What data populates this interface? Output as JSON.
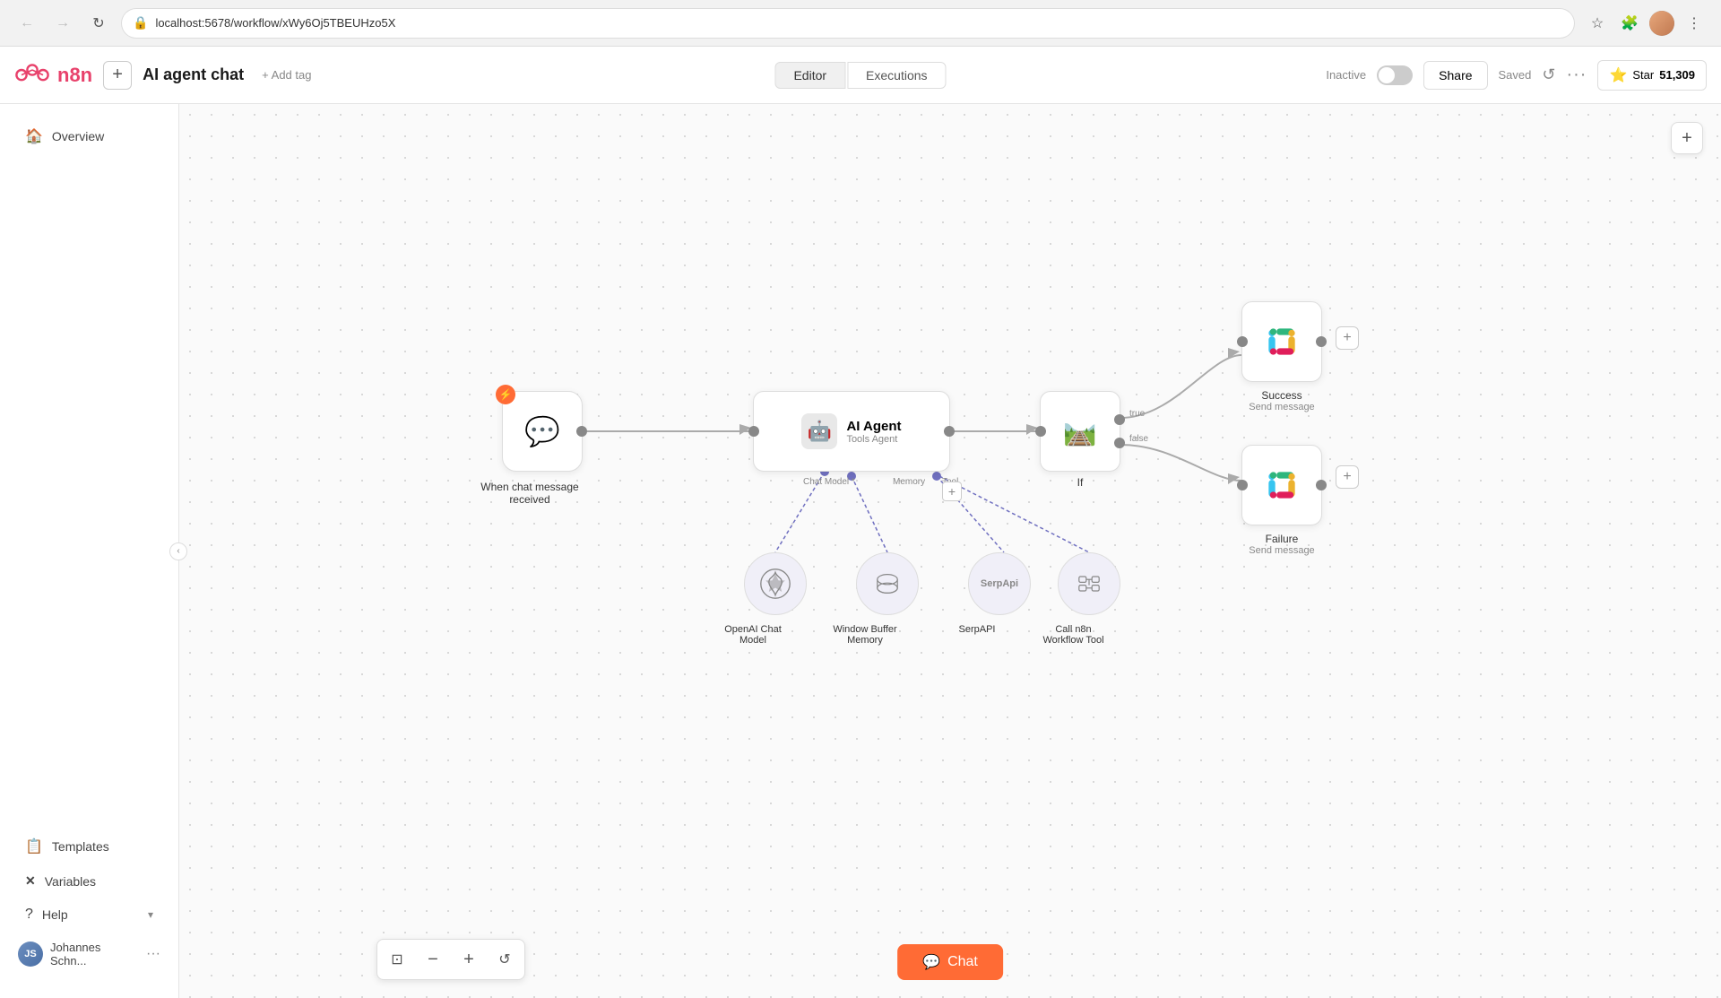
{
  "browser": {
    "url": "localhost:5678/workflow/xWy6Oj5TBEUHzo5X",
    "back_disabled": true,
    "forward_disabled": true
  },
  "app": {
    "logo_text": "n8n",
    "add_button_label": "+",
    "workflow_name": "AI agent chat",
    "add_tag_label": "+ Add tag",
    "tabs": [
      {
        "id": "editor",
        "label": "Editor",
        "active": true
      },
      {
        "id": "executions",
        "label": "Executions",
        "active": false
      }
    ],
    "status": {
      "inactive_label": "Inactive",
      "share_label": "Share",
      "saved_label": "Saved"
    },
    "star_button": {
      "label": "Star",
      "count": "51,309"
    },
    "more_label": "···"
  },
  "sidebar": {
    "items": [
      {
        "id": "overview",
        "label": "Overview",
        "icon": "🏠"
      },
      {
        "id": "templates",
        "label": "Templates",
        "icon": "📋"
      },
      {
        "id": "variables",
        "label": "Variables",
        "icon": "✕"
      },
      {
        "id": "help",
        "label": "Help",
        "icon": "?"
      }
    ],
    "user": {
      "initials": "JS",
      "name": "Johannes Schn...",
      "more_label": "···"
    }
  },
  "workflow": {
    "nodes": {
      "trigger": {
        "label": "When chat message",
        "label2": "received"
      },
      "ai_agent": {
        "title": "AI Agent",
        "subtitle": "Tools Agent",
        "chat_model_label": "Chat Model *",
        "memory_label": "Memory",
        "tool_label": "Tool"
      },
      "if_node": {
        "label": "If",
        "true_label": "true",
        "false_label": "false"
      },
      "slack_success": {
        "label": "Success",
        "sublabel": "Send message"
      },
      "slack_failure": {
        "label": "Failure",
        "sublabel": "Send message"
      },
      "openai": {
        "label": "OpenAI Chat",
        "label2": "Model"
      },
      "memory": {
        "label": "Window Buffer",
        "label2": "Memory"
      },
      "serpapi": {
        "label": "SerpAPI"
      },
      "workflow_tool": {
        "label": "Call n8n",
        "label2": "Workflow Tool"
      }
    }
  },
  "bottom_toolbar": {
    "fit_view": "⊡",
    "zoom_out": "−",
    "zoom_in": "+",
    "reset": "↺"
  },
  "chat_button": {
    "label": "Chat",
    "icon": "💬"
  },
  "canvas_plus": "+"
}
